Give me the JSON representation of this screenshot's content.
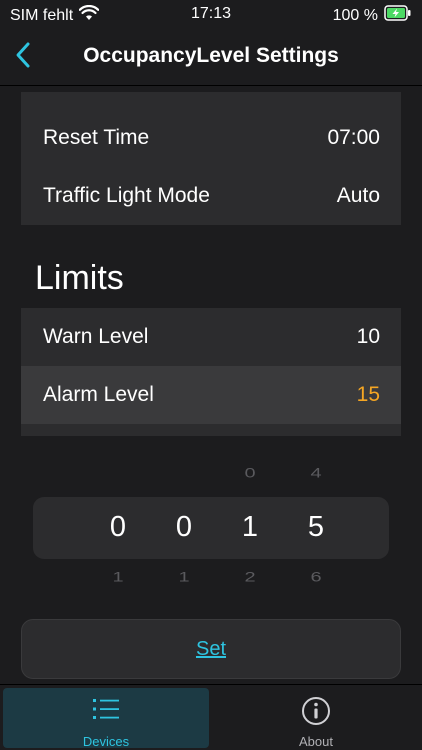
{
  "status_bar": {
    "carrier": "SIM fehlt",
    "time": "17:13",
    "battery": "100 %"
  },
  "nav": {
    "title": "OccupancyLevel Settings",
    "back_icon": "chevron-left-icon"
  },
  "settings": {
    "reset_time_label": "Reset Time",
    "reset_time_value": "07:00",
    "traffic_light_label": "Traffic Light Mode",
    "traffic_light_value": "Auto"
  },
  "limits": {
    "title": "Limits",
    "warn_label": "Warn Level",
    "warn_value": "10",
    "alarm_label": "Alarm Level",
    "alarm_value": "15"
  },
  "picker": {
    "columns": [
      {
        "above": "",
        "selected": "0",
        "below": "1"
      },
      {
        "above": "",
        "selected": "0",
        "below": "1"
      },
      {
        "above": "0",
        "selected": "1",
        "below": "2"
      },
      {
        "above": "4",
        "selected": "5",
        "below": "6"
      }
    ]
  },
  "set_button": {
    "label": "Set"
  },
  "tabs": [
    {
      "label": "Devices",
      "icon": "list-icon",
      "active": true
    },
    {
      "label": "About",
      "icon": "info-circle-icon",
      "active": false
    }
  ],
  "colors": {
    "accent": "#2ec4e0",
    "alarm_value": "#f5a623",
    "background": "#1c1c1e",
    "card": "#2c2c2e",
    "battery_green": "#4cd964"
  }
}
